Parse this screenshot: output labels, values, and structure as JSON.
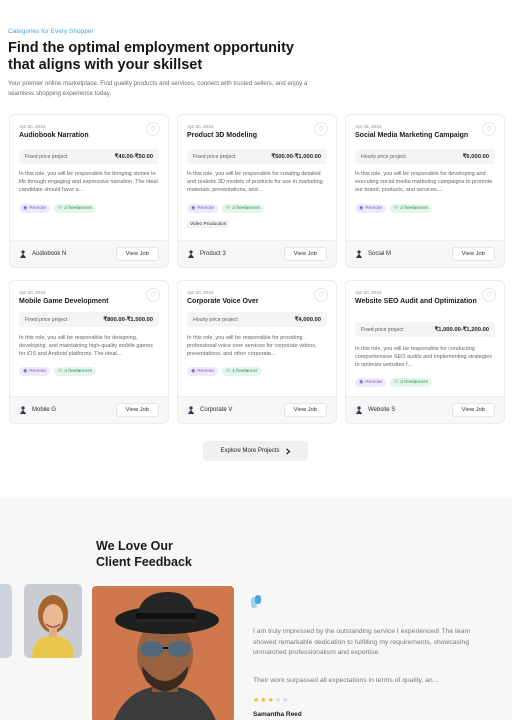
{
  "hero": {
    "eyebrow": "Categories for Every Shopper",
    "title": "Find the optimal employment opportunity that aligns with your skillset",
    "subtitle": "Your premier online marketplace. Find quality products and services, connect with trusted sellers, and enjoy a seamless shopping experience today."
  },
  "jobs": [
    {
      "date": "Apr 30, 2024",
      "title": "Audiobook Narration",
      "price_type": "Fixed price project",
      "price": "₹40.00-₹50.00",
      "description": "In this role, you will be responsible for bringing stories to life through engaging and expressive narration. The ideal candidate should have a...",
      "location": "Remote",
      "freelancers": "2 freelancers",
      "category": "",
      "company": "Audiobook N",
      "button": "View Job"
    },
    {
      "date": "Apr 30, 2024",
      "title": "Product 3D Modeling",
      "price_type": "Fixed price project",
      "price": "₹500.00-₹1,000.00",
      "description": "In this role, you will be responsible for creating detailed and realistic 3D models of products for use in marketing materials, presentations, and...",
      "location": "Remote",
      "freelancers": "2 freelancers",
      "category": "Video Production",
      "company": "Product 3",
      "button": "View Job"
    },
    {
      "date": "Apr 26, 2024",
      "title": "Social Media Marketing Campaign",
      "price_type": "Hourly price project",
      "price": "₹6,000.00",
      "description": "In this role, you will be responsible for developing and executing social media marketing campaigns to promote our brand, products, and services....",
      "location": "Remote",
      "freelancers": "2 freelancers",
      "category": "",
      "company": "Social M",
      "button": "View Job"
    },
    {
      "date": "Apr 30, 2024",
      "title": "Mobile Game Development",
      "price_type": "Fixed price project",
      "price": "₹800.00-₹1,500.00",
      "description": "In this role, you will be responsible for designing, developing, and maintaining high-quality mobile games for iOS and Android platforms. The ideal...",
      "location": "Remote",
      "freelancers": "3 freelancers",
      "category": "",
      "company": "Mobile G",
      "button": "View Job"
    },
    {
      "date": "Apr 30, 2024",
      "title": "Corporate Voice Over",
      "price_type": "Hourly price project",
      "price": "₹4,000.00",
      "description": "In this role, you will be responsible for providing professional voice over services for corporate videos, presentations, and other corporate...",
      "location": "Remote",
      "freelancers": "1 freelancer",
      "category": "",
      "company": "Corporate V",
      "button": "View Job"
    },
    {
      "date": "Apr 30, 2024",
      "title": "Website SEO Audit and Optimization",
      "price_type": "Fixed price project",
      "price": "₹1,000.00-₹1,200.00",
      "description": "In this role, you will be responsible for conducting comprehensive SEO audits and implementing strategies to optimize websites f...",
      "location": "Remote",
      "freelancers": "3 freelancers",
      "category": "",
      "company": "Website S",
      "button": "View Job"
    }
  ],
  "explore_button": "Explore More Projects",
  "feedback": {
    "title_line1": "We Love Our",
    "title_line2": "Client Feedback",
    "quote": "I am truly impressed by the outstanding service I experienced! The team showed remarkable dedication to fulfilling my requirements, showcasing unmatched professionalism and expertise.",
    "quote_more": "Their work surpassed all expectations in terms of quality, an...",
    "rating": 3,
    "rating_max": 5,
    "reviewer": "Samantha Reed"
  },
  "colors": {
    "accent_blue": "#4aa3df",
    "remote_tag": "#7a5bc9",
    "freelancer_tag": "#2e8b57",
    "star": "#f0b429"
  }
}
